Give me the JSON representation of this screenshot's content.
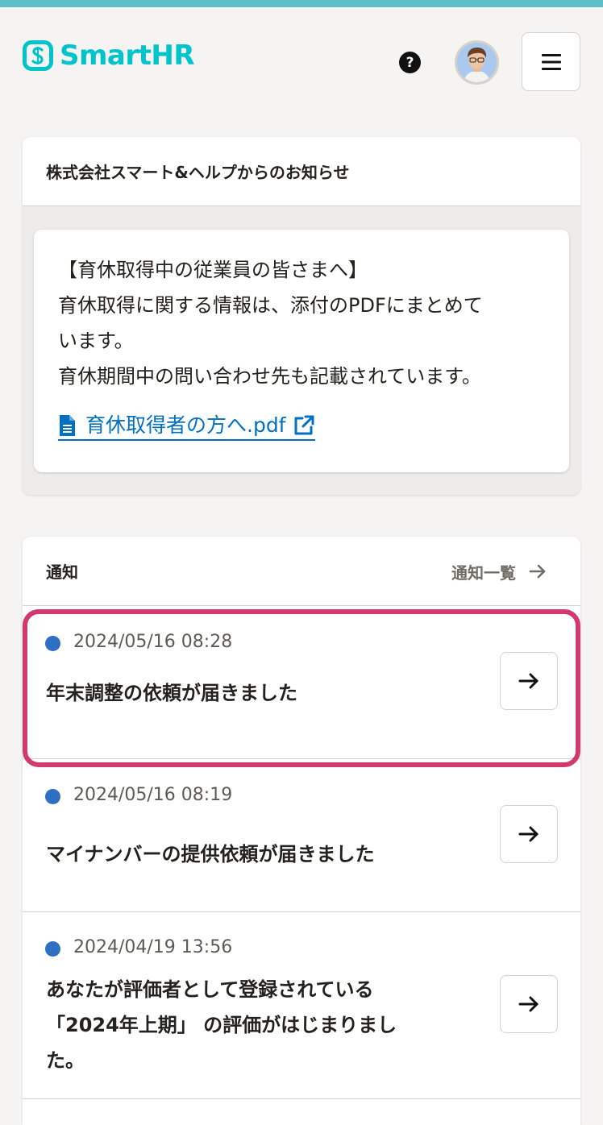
{
  "header": {
    "logo_text": "SmartHR",
    "help_icon_label": "?",
    "brand_color": "#00c4cc",
    "accent_color": "#5bbfc4"
  },
  "notice": {
    "header": "株式会社スマート&ヘルプからのお知らせ",
    "lines": [
      "【育休取得中の従業員の皆さまへ】",
      "育休取得に関する情報は、添付のPDFにまとめて",
      "います。",
      "育休期間中の問い合わせ先も記載されています。"
    ],
    "pdf_link": "育休取得者の方へ.pdf"
  },
  "notifications": {
    "header": "通知",
    "list_link": "通知一覧",
    "items": [
      {
        "date": "2024/05/16 08:28",
        "title_lines": [
          "年末調整の依頼が届きました"
        ],
        "unread": true,
        "highlighted": true
      },
      {
        "date": "2024/05/16 08:19",
        "title_lines": [
          "マイナンバーの提供依頼が届きました"
        ],
        "unread": true,
        "highlighted": false
      },
      {
        "date": "2024/04/19 13:56",
        "title_lines": [
          "あなたが評価者として登録されている",
          "「2024年上期」 の評価がはじまりまし",
          "た。"
        ],
        "unread": true,
        "highlighted": false
      }
    ]
  },
  "colors": {
    "unread_dot": "#2f6fc3",
    "link": "#0071c1",
    "highlight_border": "#d23a6f"
  }
}
